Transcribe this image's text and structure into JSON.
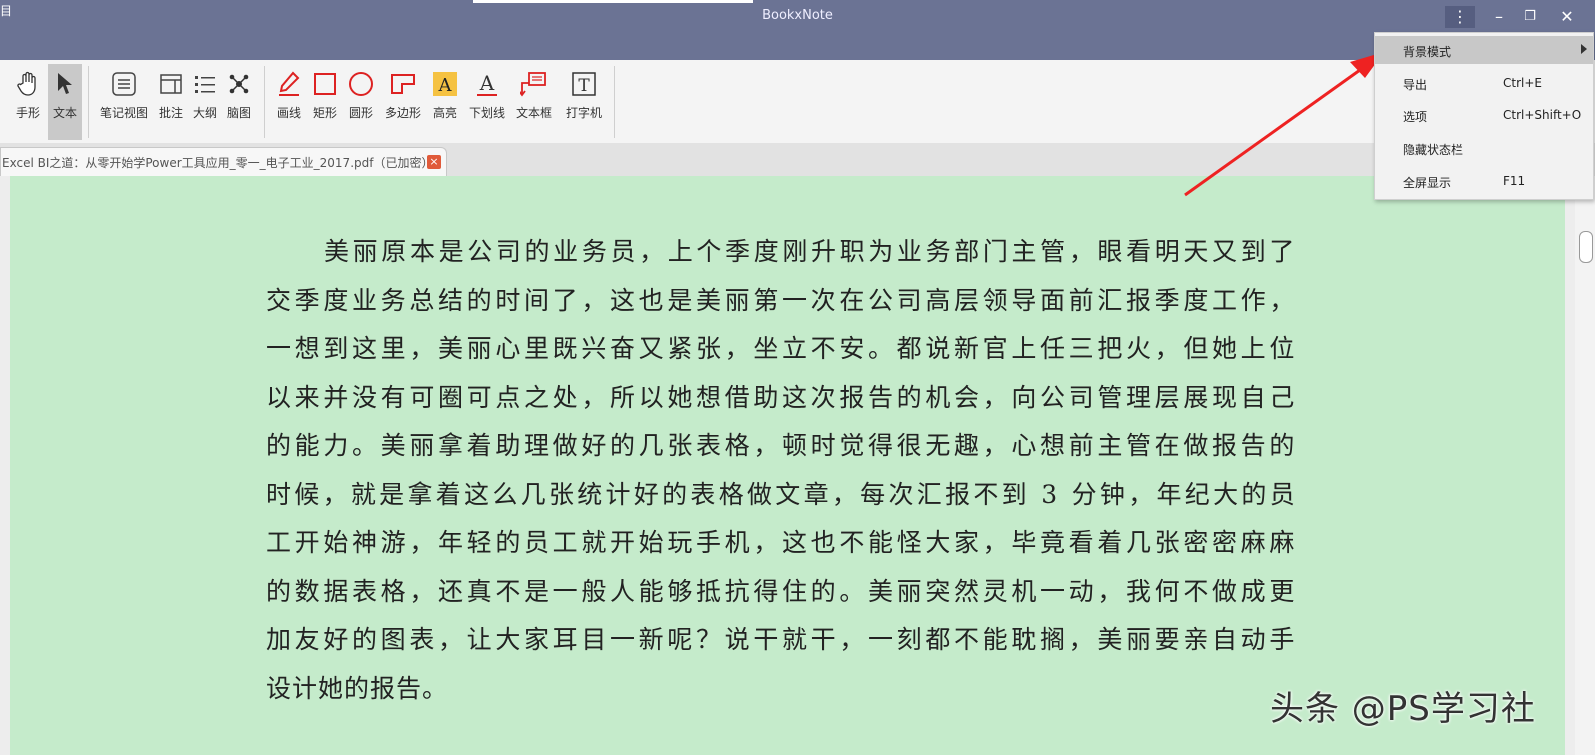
{
  "window": {
    "title": "BookxNote",
    "corner_icon": "目"
  },
  "toolbar": {
    "tools": [
      {
        "label": "手形",
        "icon": "hand-icon"
      },
      {
        "label": "文本",
        "icon": "cursor-icon"
      },
      {
        "label": "笔记视图",
        "icon": "notes-view-icon"
      },
      {
        "label": "批注",
        "icon": "annotation-icon"
      },
      {
        "label": "大纲",
        "icon": "outline-icon"
      },
      {
        "label": "脑图",
        "icon": "mindmap-icon"
      },
      {
        "label": "画线",
        "icon": "pen-icon"
      },
      {
        "label": "矩形",
        "icon": "rectangle-icon"
      },
      {
        "label": "圆形",
        "icon": "circle-icon"
      },
      {
        "label": "多边形",
        "icon": "polygon-icon"
      },
      {
        "label": "高亮",
        "icon": "highlight-icon"
      },
      {
        "label": "下划线",
        "icon": "underline-icon"
      },
      {
        "label": "文本框",
        "icon": "textbox-icon"
      },
      {
        "label": "打字机",
        "icon": "typewriter-icon"
      }
    ]
  },
  "tab": {
    "label": "Excel BI之道：从零开始学Power工具应用_零一_电子工业_2017.pdf（已加密）",
    "close": "×"
  },
  "document": {
    "lines": [
      "美丽原本是公司的业务员，上个季度刚升职为业务部门主管，眼看明天又到了",
      "交季度业务总结的时间了，这也是美丽第一次在公司高层领导面前汇报季度工作，",
      "一想到这里，美丽心里既兴奋又紧张，坐立不安。都说新官上任三把火，但她上位",
      "以来并没有可圈可点之处，所以她想借助这次报告的机会，向公司管理层展现自己",
      "的能力。美丽拿着助理做好的几张表格，顿时觉得很无趣，心想前主管在做报告的",
      "时候，就是拿着这么几张统计好的表格做文章，每次汇报不到 3 分钟，年纪大的员",
      "工开始神游，年轻的员工就开始玩手机，这也不能怪大家，毕竟看着几张密密麻麻",
      "的数据表格，还真不是一般人能够抵抗得住的。美丽突然灵机一动，我何不做成更",
      "加友好的图表，让大家耳目一新呢？说干就干，一刻都不能耽搁，美丽要亲自动手",
      "设计她的报告。"
    ],
    "page_color": "#c5ebcb"
  },
  "watermark": "头条 @PS学习社",
  "menu": {
    "items": [
      {
        "label": "背景模式",
        "shortcut": "",
        "submenu": true
      },
      {
        "label": "导出",
        "shortcut": "Ctrl+E"
      },
      {
        "label": "选项",
        "shortcut": "Ctrl+Shift+O"
      },
      {
        "label": "隐藏状态栏",
        "shortcut": ""
      },
      {
        "label": "全屏显示",
        "shortcut": "F11"
      }
    ]
  },
  "colors": {
    "titlebar": "#6b7394",
    "arrow": "#ee2222",
    "close_tab": "#e05a3a"
  }
}
